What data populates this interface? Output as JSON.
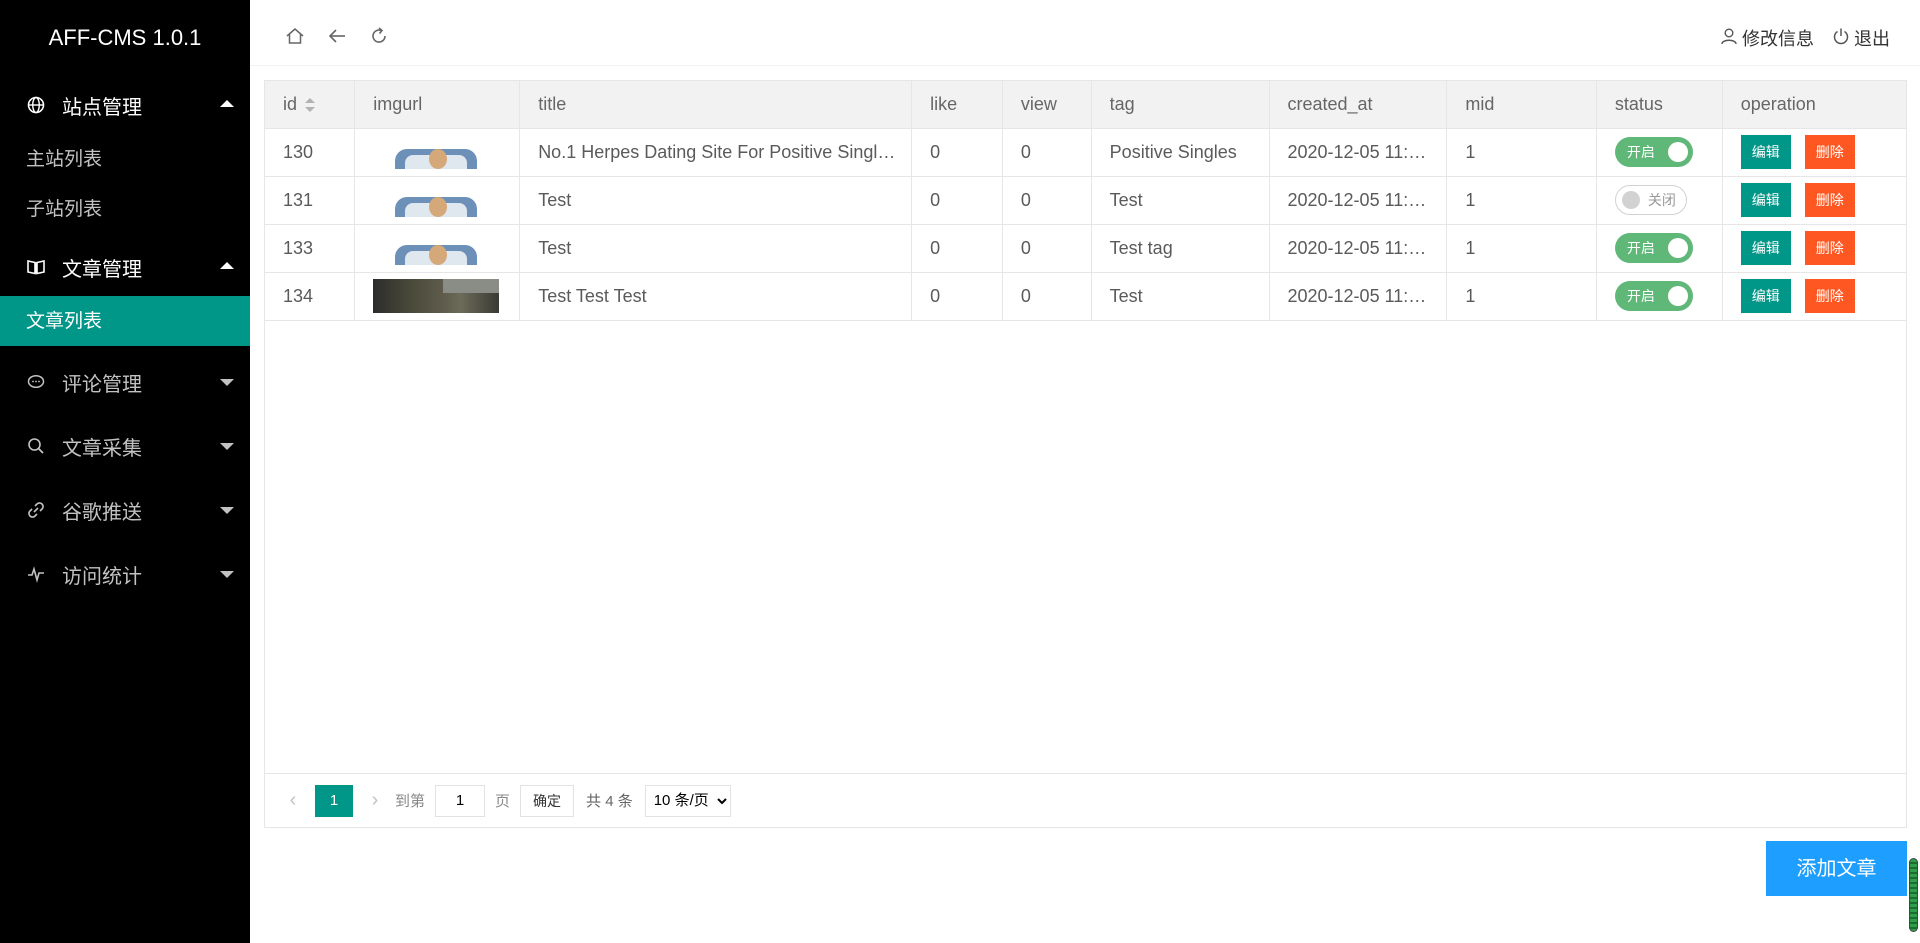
{
  "app": {
    "title": "AFF-CMS 1.0.1"
  },
  "sidebar": {
    "groups": [
      {
        "label": "站点管理",
        "items": [
          "主站列表",
          "子站列表"
        ]
      },
      {
        "label": "文章管理",
        "items": [
          "文章列表"
        ]
      },
      {
        "label": "评论管理"
      },
      {
        "label": "文章采集"
      },
      {
        "label": "谷歌推送"
      },
      {
        "label": "访问统计"
      }
    ],
    "active_item": "文章列表",
    "accent_color": "#009688"
  },
  "header": {
    "icons": [
      "home-icon",
      "back-icon",
      "refresh-icon"
    ],
    "edit_info": "修改信息",
    "logout": "退出"
  },
  "table": {
    "columns": [
      "id",
      "imgurl",
      "title",
      "like",
      "view",
      "tag",
      "created_at",
      "mid",
      "status",
      "operation"
    ],
    "rows": [
      {
        "id": "130",
        "title": "No.1 Herpes Dating Site For Positive Singl…",
        "like": "0",
        "view": "0",
        "tag": "Positive Singles",
        "created_at": "2020-12-05 11:…",
        "mid": "1",
        "status": "开启",
        "status_on": true
      },
      {
        "id": "131",
        "title": "Test",
        "like": "0",
        "view": "0",
        "tag": "Test",
        "created_at": "2020-12-05 11:…",
        "mid": "1",
        "status": "关闭",
        "status_on": false
      },
      {
        "id": "133",
        "title": "Test",
        "like": "0",
        "view": "0",
        "tag": "Test tag",
        "created_at": "2020-12-05 11:…",
        "mid": "1",
        "status": "开启",
        "status_on": true
      },
      {
        "id": "134",
        "title": "Test Test Test",
        "like": "0",
        "view": "0",
        "tag": "Test",
        "created_at": "2020-12-05 11:…",
        "mid": "1",
        "status": "开启",
        "status_on": true
      }
    ],
    "edit_label": "编辑",
    "delete_label": "删除"
  },
  "pager": {
    "current_page": "1",
    "goto_label": "到第",
    "page_input": "1",
    "page_unit": "页",
    "confirm": "确定",
    "total": "共 4 条",
    "page_size": "10 条/页"
  },
  "add_button": "添加文章",
  "colors": {
    "primary": "#009688",
    "danger": "#ff5722",
    "blue": "#1e9fff",
    "switch_on": "#5fb878"
  }
}
